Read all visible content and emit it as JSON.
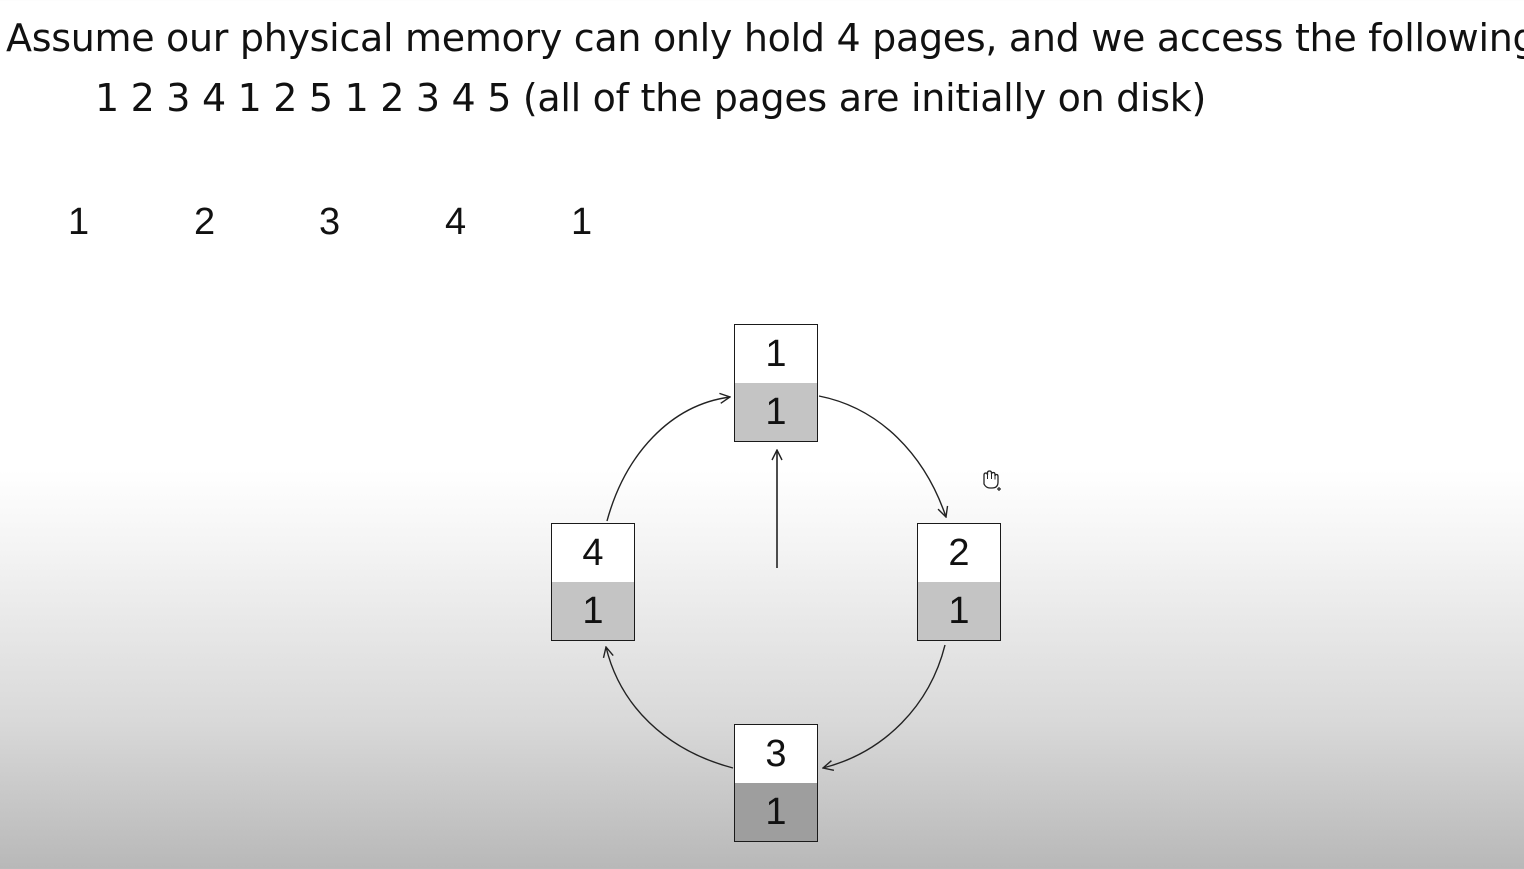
{
  "header": {
    "line1": "Assume our physical memory can only hold 4 pages, and we access the following:",
    "line2": "1 2 3 4 1 2 5 1 2 3 4 5 (all of the pages are initially on disk)"
  },
  "accesses_shown": [
    "1",
    "2",
    "3",
    "4",
    "1"
  ],
  "frames": [
    {
      "page": "1",
      "ref": "1"
    },
    {
      "page": "2",
      "ref": "1"
    },
    {
      "page": "3",
      "ref": "1"
    },
    {
      "page": "4",
      "ref": "1"
    }
  ],
  "icons": {
    "cursor": "hand-grab-icon"
  }
}
